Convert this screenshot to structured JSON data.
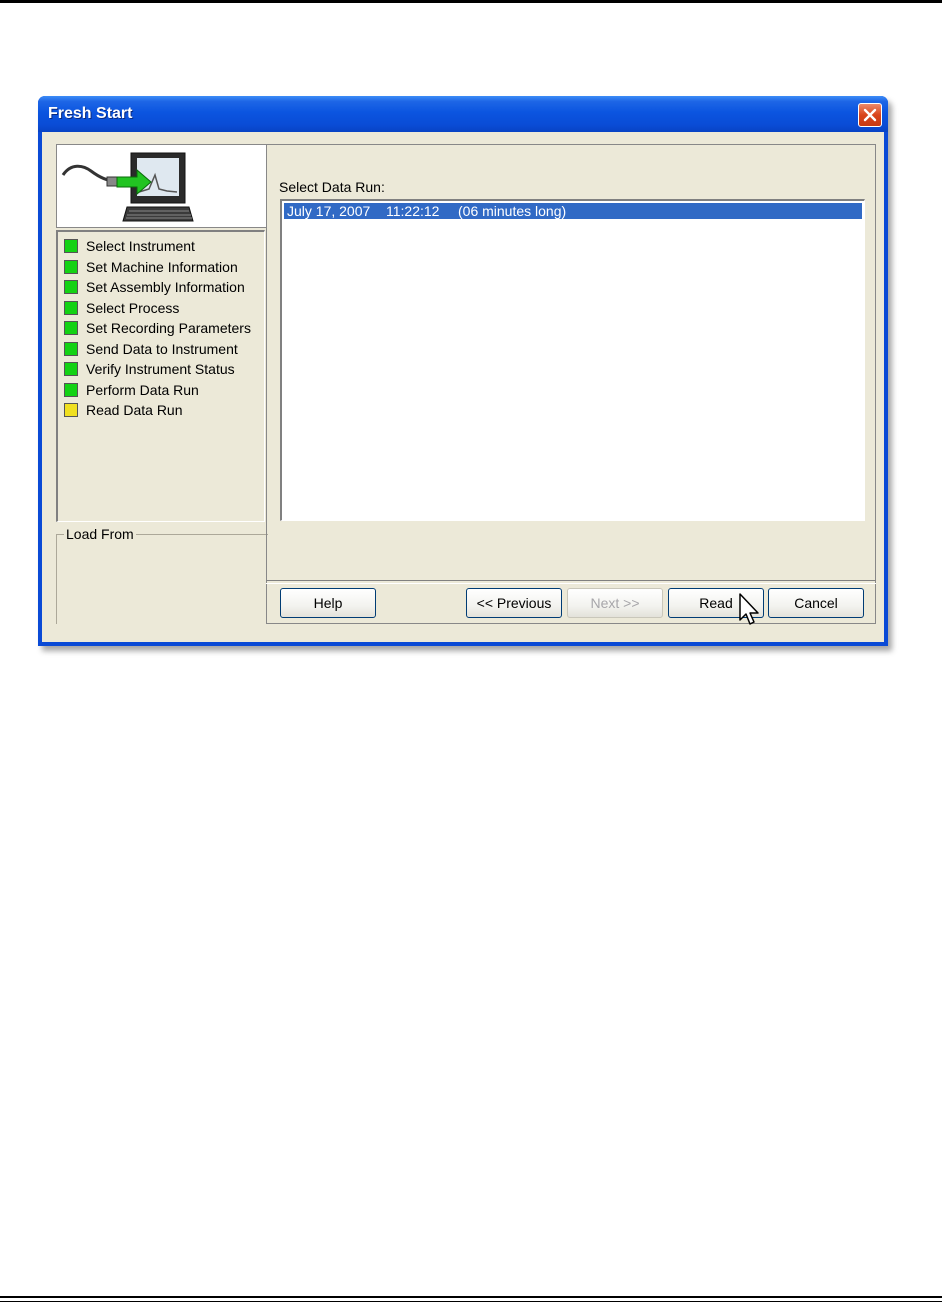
{
  "window": {
    "title": "Fresh Start",
    "colors": {
      "title_bar": "#0a4ad6",
      "client": "#ece9d8",
      "selection": "#316ac5"
    }
  },
  "steps": [
    {
      "label": "Select Instrument",
      "status": "complete",
      "color": "#14d214"
    },
    {
      "label": "Set Machine Information",
      "status": "complete",
      "color": "#14d214"
    },
    {
      "label": "Set Assembly Information",
      "status": "complete",
      "color": "#14d214"
    },
    {
      "label": "Select Process",
      "status": "complete",
      "color": "#14d214"
    },
    {
      "label": "Set Recording Parameters",
      "status": "complete",
      "color": "#14d214"
    },
    {
      "label": "Send Data to Instrument",
      "status": "complete",
      "color": "#14d214"
    },
    {
      "label": "Verify Instrument Status",
      "status": "complete",
      "color": "#14d214"
    },
    {
      "label": "Perform Data Run",
      "status": "complete",
      "color": "#14d214"
    },
    {
      "label": "Read Data Run",
      "status": "current",
      "color": "#f0e020"
    }
  ],
  "load_from": {
    "label": "Load From"
  },
  "data_run": {
    "label": "Select Data Run:",
    "items": [
      {
        "date": "July 17, 2007",
        "time": "11:22:12",
        "duration": "(06 minutes long)",
        "selected": true
      }
    ]
  },
  "buttons": {
    "help": "Help",
    "previous": "<< Previous",
    "next": "Next >>",
    "read": "Read",
    "cancel": "Cancel"
  },
  "icons": {
    "close": "close-icon",
    "logo": "computer-transfer-icon",
    "cursor": "mouse-pointer-icon"
  }
}
